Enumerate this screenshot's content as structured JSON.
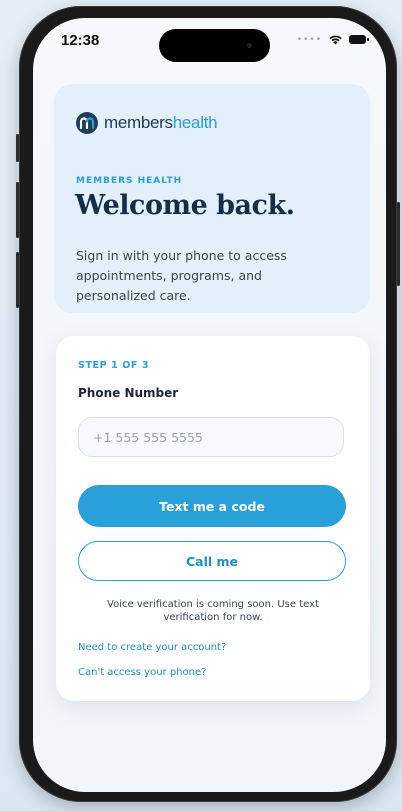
{
  "status_bar": {
    "time": "12:38",
    "signal_icon": "signal-dots-icon",
    "wifi_icon": "wifi-icon",
    "battery_icon": "battery-icon"
  },
  "hero": {
    "brand_part1": "members",
    "brand_part2": "health",
    "eyebrow": "MEMBERS HEALTH",
    "title": "Welcome back.",
    "subtitle": "Sign in with your phone to access appointments, programs, and personalized care."
  },
  "form": {
    "step": "STEP 1 OF 3",
    "phone_label": "Phone Number",
    "phone_placeholder": "+1 555 555 5555",
    "phone_value": "",
    "primary_button": "Text me a code",
    "secondary_button": "Call me",
    "note": "Voice verification is coming soon. Use text verification for now.",
    "link_create": "Need to create your account?",
    "link_access": "Can't access your phone?"
  },
  "colors": {
    "accent": "#2aa0db",
    "title": "#152f4a",
    "hero_bg": "#e3f0f9"
  }
}
